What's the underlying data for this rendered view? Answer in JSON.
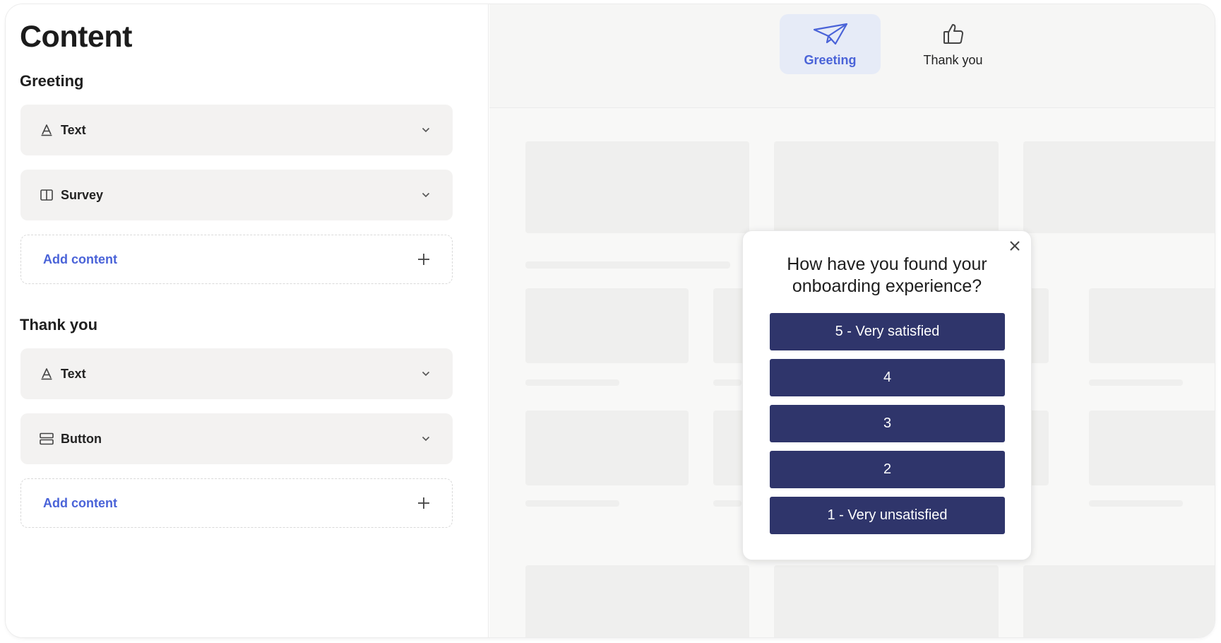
{
  "editor": {
    "title": "Content",
    "sections": [
      {
        "title": "Greeting",
        "items": [
          {
            "label": "Text",
            "icon": "text-format-icon"
          },
          {
            "label": "Survey",
            "icon": "columns-icon"
          }
        ],
        "add_label": "Add content"
      },
      {
        "title": "Thank you",
        "items": [
          {
            "label": "Text",
            "icon": "text-format-icon"
          },
          {
            "label": "Button",
            "icon": "button-layout-icon"
          }
        ],
        "add_label": "Add content"
      }
    ]
  },
  "preview": {
    "tabs": [
      {
        "label": "Greeting",
        "icon": "paper-plane-icon",
        "active": true
      },
      {
        "label": "Thank you",
        "icon": "thumbs-up-icon",
        "active": false
      }
    ],
    "survey": {
      "question_line1": "How have you found your",
      "question_line2": "onboarding experience?",
      "options": [
        "5 - Very satisfied",
        "4",
        "3",
        "2",
        "1 - Very unsatisfied"
      ]
    }
  },
  "colors": {
    "accent": "#4a63d8",
    "survey_button": "#2f356b",
    "active_tab_bg": "#e6ebf7",
    "row_bg": "#f3f2f1"
  }
}
